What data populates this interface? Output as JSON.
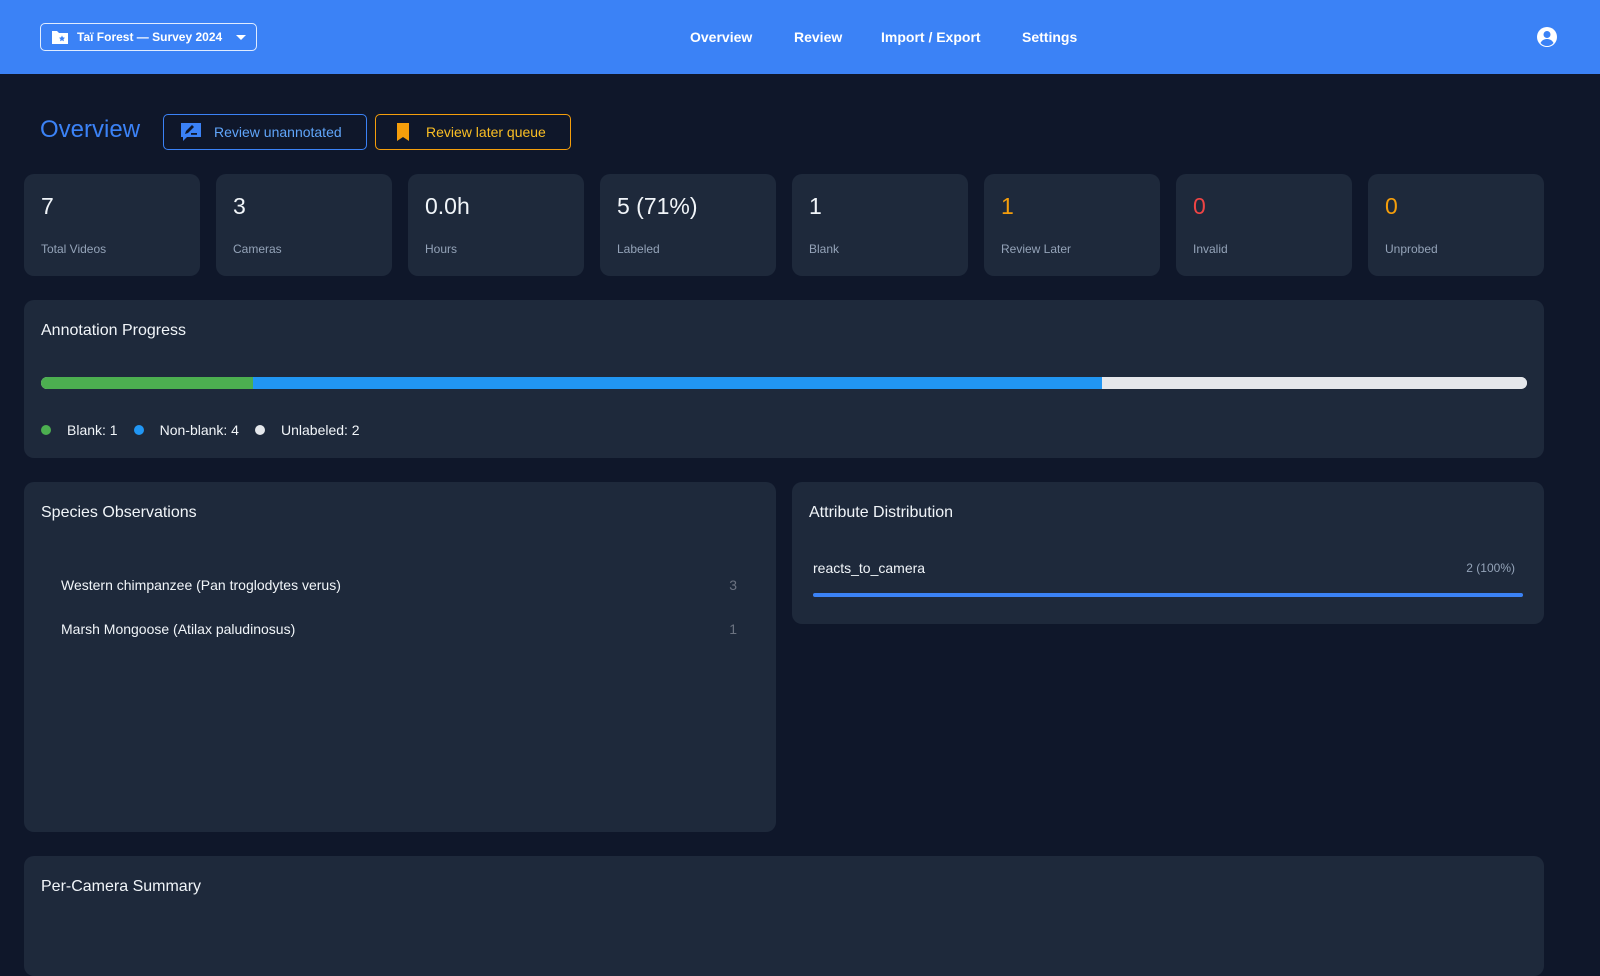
{
  "header": {
    "project_selector": {
      "label": "Taï Forest — Survey 2024",
      "icon": "folder-star-icon"
    },
    "nav": [
      "Overview",
      "Review",
      "Import / Export",
      "Settings"
    ],
    "account_icon": "account-circle-icon"
  },
  "page": {
    "title": "Overview",
    "review_unannotated_label": "Review unannotated",
    "review_later_label": "Review later queue"
  },
  "stats": [
    {
      "value": "7",
      "label": "Total Videos",
      "color": "#f1f5f9"
    },
    {
      "value": "3",
      "label": "Cameras",
      "color": "#f1f5f9"
    },
    {
      "value": "0.0h",
      "label": "Hours",
      "color": "#f1f5f9"
    },
    {
      "value": "5 (71%)",
      "label": "Labeled",
      "color": "#f1f5f9"
    },
    {
      "value": "1",
      "label": "Blank",
      "color": "#f1f5f9"
    },
    {
      "value": "1",
      "label": "Review Later",
      "color": "#f59e0b"
    },
    {
      "value": "0",
      "label": "Invalid",
      "color": "#ef4444"
    },
    {
      "value": "0",
      "label": "Unprobed",
      "color": "#f59e0b"
    }
  ],
  "annotation_progress": {
    "title": "Annotation Progress",
    "segments": [
      {
        "key": "blank",
        "label": "Blank: 1",
        "count": 1,
        "color": "#4caf50"
      },
      {
        "key": "non-blank",
        "label": "Non-blank: 4",
        "count": 4,
        "color": "#2196f3"
      },
      {
        "key": "unlabeled",
        "label": "Unlabeled: 2",
        "count": 2,
        "color": "#e5e7eb"
      }
    ],
    "total": 7
  },
  "species": {
    "title": "Species Observations",
    "rows": [
      {
        "name": "Western chimpanzee (Pan troglodytes verus)",
        "count": "3"
      },
      {
        "name": "Marsh Mongoose (Atilax paludinosus)",
        "count": "1"
      }
    ]
  },
  "attributes": {
    "title": "Attribute Distribution",
    "rows": [
      {
        "name": "reacts_to_camera",
        "value": "2 (100%)",
        "fraction": 1.0
      }
    ]
  },
  "per_camera": {
    "title": "Per-Camera Summary"
  }
}
